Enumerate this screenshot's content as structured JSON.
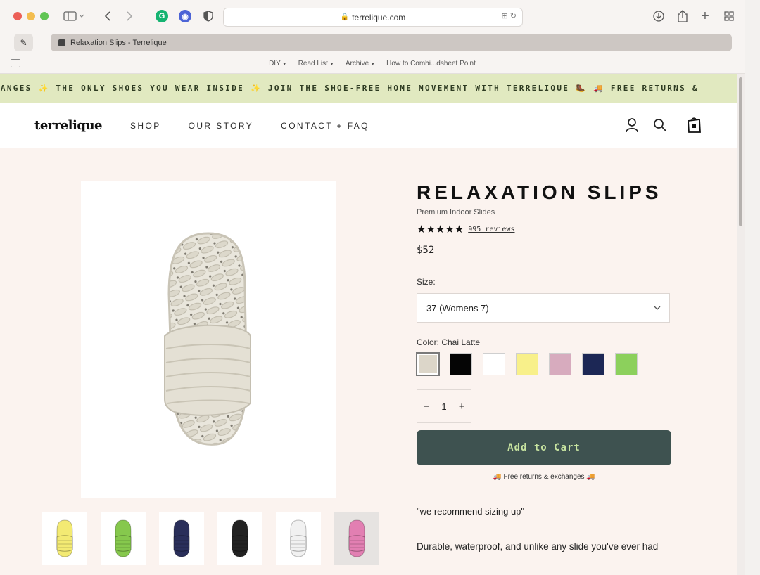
{
  "browser": {
    "url": "terrelique.com",
    "tab_title": "Relaxation Slips - Terrelique",
    "favorites": [
      "DIY",
      "Read List",
      "Archive",
      "How to Combi...dsheet Point"
    ],
    "favorites_has_menu": [
      true,
      true,
      true,
      false
    ]
  },
  "marquee": {
    "text": "HANGES ✨ THE ONLY SHOES YOU WEAR INSIDE ✨ JOIN THE SHOE-FREE HOME MOVEMENT WITH TERRELIQUE 🥾   🚚 FREE RETURNS &"
  },
  "nav": {
    "logo": "terrelique",
    "links": [
      "SHOP",
      "OUR STORY",
      "CONTACT + FAQ"
    ]
  },
  "product": {
    "title": "RELAXATION SLIPS",
    "subtitle": "Premium Indoor Slides",
    "stars": "★★★★★",
    "rating": 5,
    "reviews": "995 reviews",
    "price": "$52",
    "size_label": "Size:",
    "size_value": "37 (Womens 7)",
    "color_label": "Color: Chai Latte",
    "colors": [
      "#dcd6c9",
      "#050505",
      "#ffffff",
      "#f8f08a",
      "#d7abbe",
      "#1c2755",
      "#8cd05c"
    ],
    "selected_color_index": 0,
    "quantity": "1",
    "add_to_cart": "Add to Cart",
    "free_returns": "🚚 Free returns & exchanges 🚚",
    "recommend": "\"we recommend sizing up\"",
    "description": "Durable, waterproof, and unlike any slide you've ever had",
    "thumbnail_colors": [
      "#f3ea73",
      "#86c84d",
      "#2a2f5a",
      "#222222",
      "#f1f1f1",
      "#e27fb2"
    ]
  },
  "colors": {
    "accent_button": "#3e5250",
    "button_text": "#c7e3a0",
    "marquee_bg": "#e1e9c0",
    "page_bg": "#fbf3ef"
  }
}
